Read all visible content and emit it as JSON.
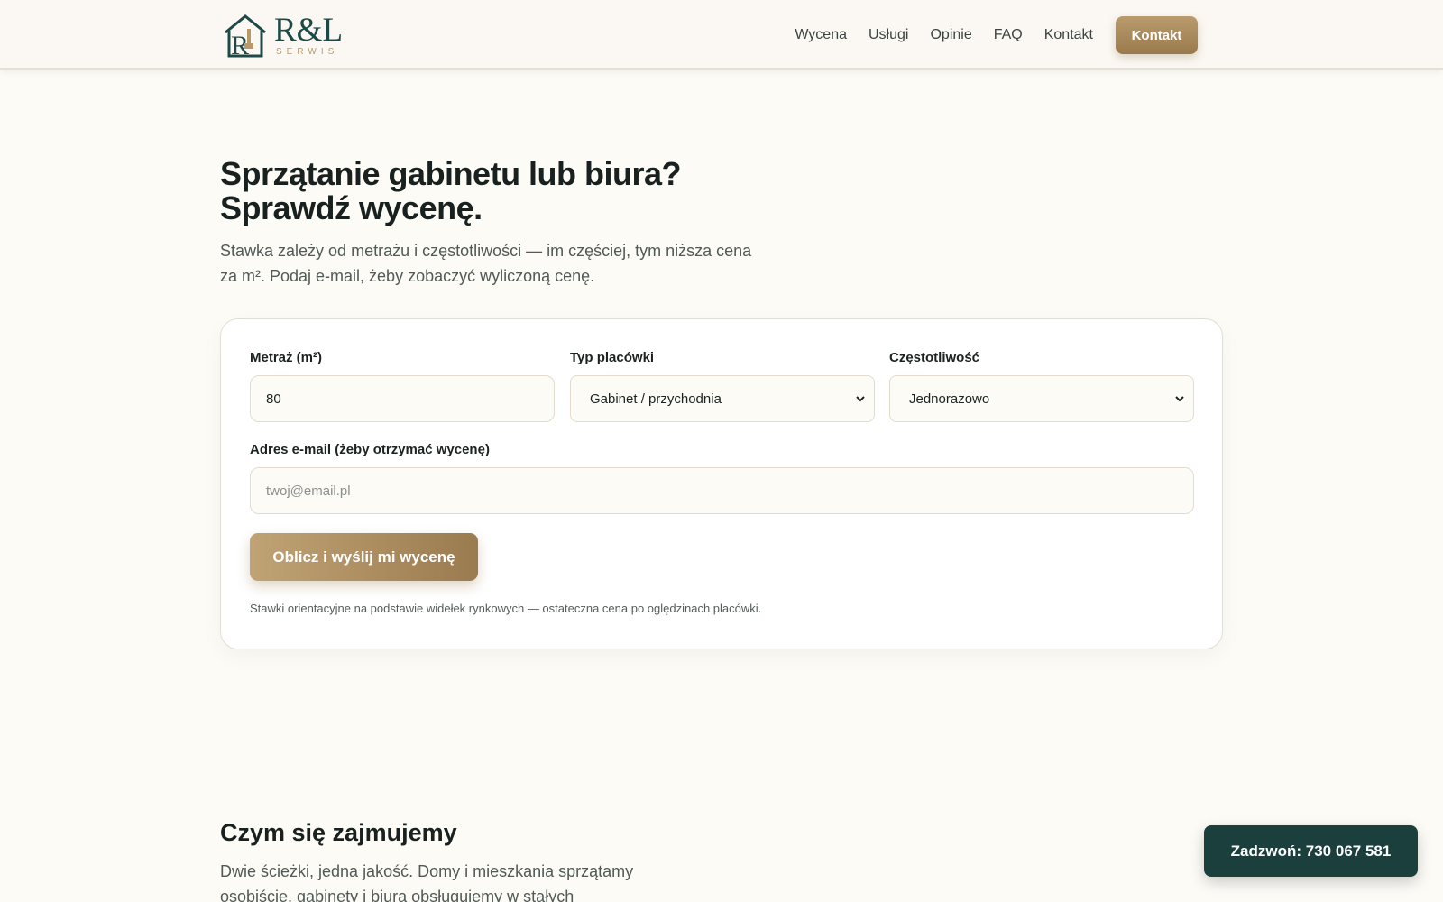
{
  "brand": {
    "name": "R&L",
    "subtitle": "SERWIS"
  },
  "nav": {
    "items": [
      "Wycena",
      "Usługi",
      "Opinie",
      "FAQ",
      "Kontakt"
    ],
    "cta": "Kontakt"
  },
  "hero": {
    "title_line1": "Sprzątanie gabinetu lub biura?",
    "title_line2": "Sprawdź wycenę.",
    "subtitle": "Stawka zależy od metrażu i częstotliwości — im częściej, tym niższa cena za m². Podaj e-mail, żeby zobaczyć wyliczoną cenę."
  },
  "form": {
    "area": {
      "label": "Metraż (m²)",
      "value": "80"
    },
    "type": {
      "label": "Typ placówki",
      "value": "Gabinet / przychodnia"
    },
    "frequency": {
      "label": "Częstotliwość",
      "value": "Jednorazowo"
    },
    "email": {
      "label": "Adres e-mail (żeby otrzymać wycenę)",
      "placeholder": "twoj@email.pl"
    },
    "submit": "Oblicz i wyślij mi wycenę",
    "note": "Stawki orientacyjne na podstawie widełek rynkowych — ostateczna cena po oględzinach placówki."
  },
  "services": {
    "title": "Czym się zajmujemy",
    "description": "Dwie ścieżki, jedna jakość. Domy i mieszkania sprzątamy osobiście, gabinety i biura obsługujemy w stałych"
  },
  "call": {
    "label": "Zadzwoń: 730 067 581"
  },
  "colors": {
    "accent": "#b08f5e",
    "dark": "#1b3f3c",
    "background": "#fdfbf6"
  }
}
